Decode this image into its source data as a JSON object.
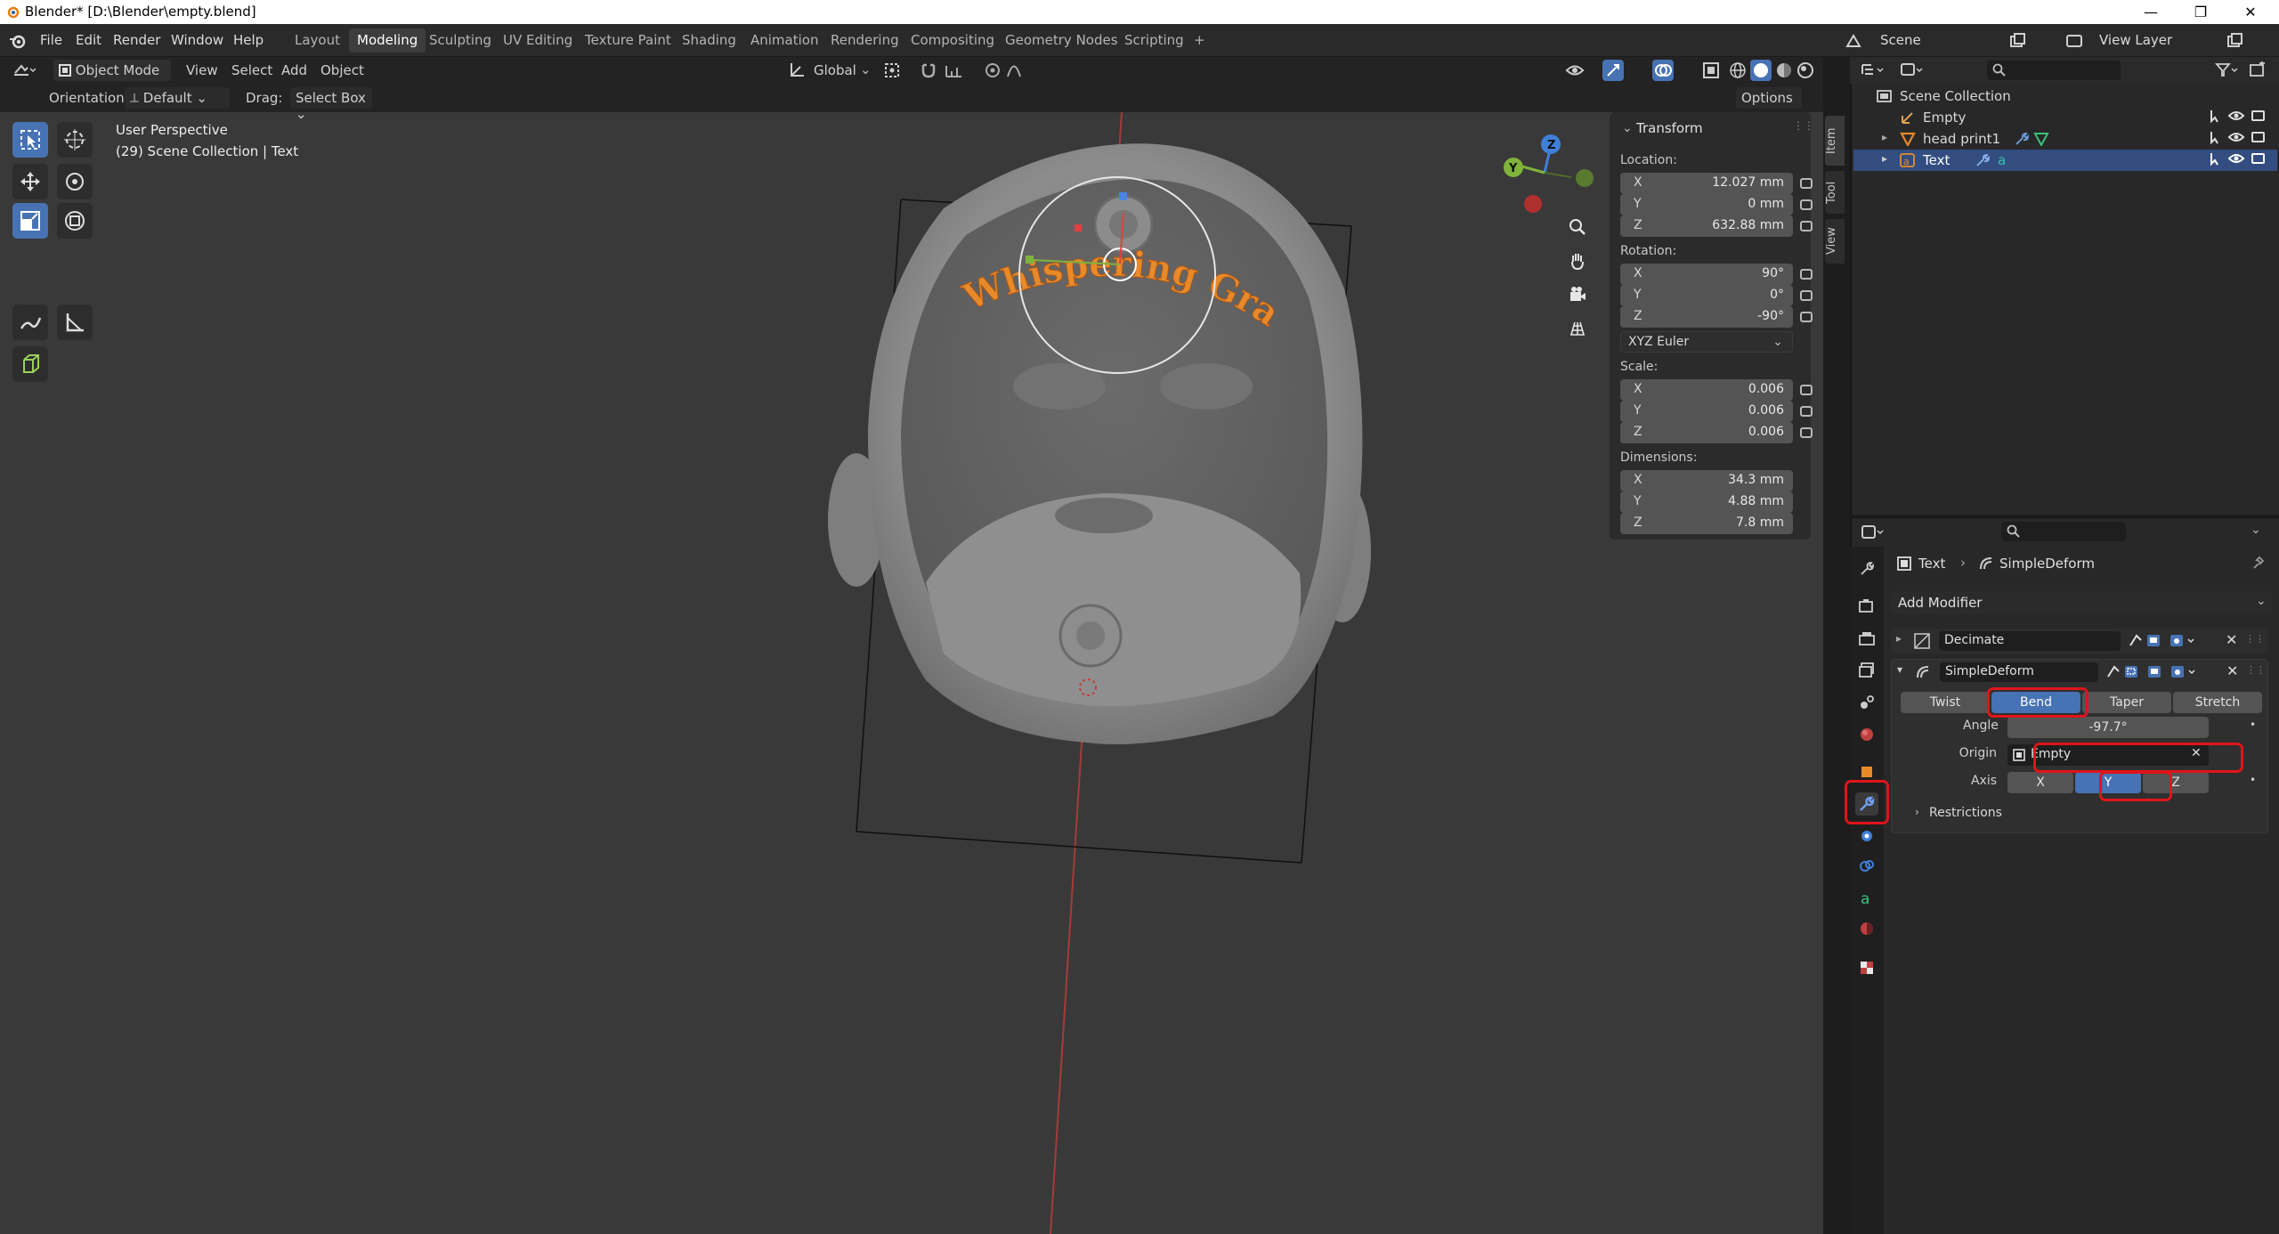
{
  "window": {
    "title": "Blender* [D:\\Blender\\empty.blend]",
    "controls": [
      "—",
      "❐",
      "✕"
    ]
  },
  "menubar": {
    "menus": [
      "File",
      "Edit",
      "Render",
      "Window",
      "Help"
    ],
    "workspaces": [
      "Layout",
      "Modeling",
      "Sculpting",
      "UV Editing",
      "Texture Paint",
      "Shading",
      "Animation",
      "Rendering",
      "Compositing",
      "Geometry Nodes",
      "Scripting"
    ],
    "active_workspace": "Modeling",
    "add_tab": "+",
    "scene_label": "Scene",
    "view_layer_label": "View Layer"
  },
  "viewport_header": {
    "mode": "Object Mode",
    "menus": [
      "View",
      "Select",
      "Add",
      "Object"
    ],
    "transform_orientation": "Global",
    "orientation_label": "Orientation:",
    "orientation_value": "Default",
    "drag_label": "Drag:",
    "drag_value": "Select Box",
    "options_label": "Options"
  },
  "viewport": {
    "view_name": "User Perspective",
    "collection_info": "(29) Scene Collection | Text",
    "curved_text": "Whispering Grass",
    "gizmo_axes": {
      "x": "X",
      "y": "Y",
      "z": "Z"
    },
    "colors": {
      "background": "#393939",
      "model": "#8a8a8a",
      "text_object": "#e8892a",
      "x_axis": "#e04040",
      "y_axis": "#7fb33c",
      "z_axis": "#3f7fd8"
    }
  },
  "tools": [
    "select-box",
    "cursor",
    "move",
    "rotate",
    "scale",
    "transform",
    "annotate",
    "measure",
    "add-cube"
  ],
  "n_panel": {
    "section": "Transform",
    "location_label": "Location:",
    "location": [
      {
        "axis": "X",
        "value": "12.027 mm"
      },
      {
        "axis": "Y",
        "value": "0 mm"
      },
      {
        "axis": "Z",
        "value": "632.88 mm"
      }
    ],
    "rotation_label": "Rotation:",
    "rotation": [
      {
        "axis": "X",
        "value": "90°"
      },
      {
        "axis": "Y",
        "value": "0°"
      },
      {
        "axis": "Z",
        "value": "-90°"
      }
    ],
    "rotation_mode": "XYZ Euler",
    "scale_label": "Scale:",
    "scale": [
      {
        "axis": "X",
        "value": "0.006"
      },
      {
        "axis": "Y",
        "value": "0.006"
      },
      {
        "axis": "Z",
        "value": "0.006"
      }
    ],
    "dimensions_label": "Dimensions:",
    "dimensions": [
      {
        "axis": "X",
        "value": "34.3 mm"
      },
      {
        "axis": "Y",
        "value": "4.88 mm"
      },
      {
        "axis": "Z",
        "value": "7.8 mm"
      }
    ],
    "tabs": [
      "Item",
      "Tool",
      "View"
    ]
  },
  "outliner": {
    "root": "Scene Collection",
    "items": [
      {
        "name": "Empty",
        "selected": false
      },
      {
        "name": "head print1",
        "selected": false
      },
      {
        "name": "Text",
        "selected": true
      }
    ]
  },
  "properties": {
    "breadcrumb_object": "Text",
    "breadcrumb_modifier": "SimpleDeform",
    "add_modifier": "Add Modifier",
    "modifiers": [
      {
        "name": "Decimate",
        "expanded": false
      },
      {
        "name": "SimpleDeform",
        "expanded": true
      }
    ],
    "deform_modes": [
      "Twist",
      "Bend",
      "Taper",
      "Stretch"
    ],
    "active_mode": "Bend",
    "angle_label": "Angle",
    "angle_value": "-97.7°",
    "origin_label": "Origin",
    "origin_value": "Empty",
    "axis_label": "Axis",
    "axes": [
      "X",
      "Y",
      "Z"
    ],
    "active_axis": "Y",
    "restrictions_label": "Restrictions"
  }
}
